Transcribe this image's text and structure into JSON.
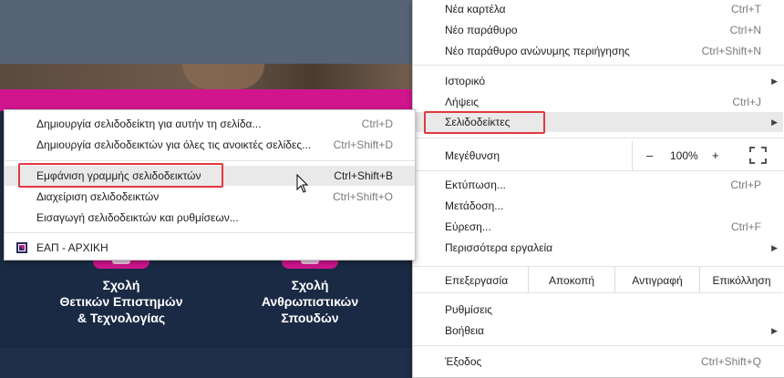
{
  "website": {
    "schools": [
      {
        "lines": [
          "Σχολή",
          "Θετικών Επιστημών",
          "& Τεχνολογίας"
        ]
      },
      {
        "lines": [
          "Σχολή",
          "Ανθρωπιστικών",
          "Σπουδών"
        ]
      }
    ]
  },
  "chrome_menu": {
    "new_tab": {
      "label": "Νέα καρτέλα",
      "shortcut": "Ctrl+T"
    },
    "new_window": {
      "label": "Νέο παράθυρο",
      "shortcut": "Ctrl+N"
    },
    "new_incognito": {
      "label": "Νέο παράθυρο ανώνυμης περιήγησης",
      "shortcut": "Ctrl+Shift+N"
    },
    "history": {
      "label": "Ιστορικό"
    },
    "downloads": {
      "label": "Λήψεις",
      "shortcut": "Ctrl+J"
    },
    "bookmarks": {
      "label": "Σελιδοδείκτες"
    },
    "zoom": {
      "label": "Μεγέθυνση",
      "minus": "–",
      "value": "100%",
      "plus": "+"
    },
    "print": {
      "label": "Εκτύπωση...",
      "shortcut": "Ctrl+P"
    },
    "cast": {
      "label": "Μετάδοση..."
    },
    "find": {
      "label": "Εύρεση...",
      "shortcut": "Ctrl+F"
    },
    "more_tools": {
      "label": "Περισσότερα εργαλεία"
    },
    "edit": {
      "label": "Επεξεργασία",
      "cut": "Αποκοπή",
      "copy": "Αντιγραφή",
      "paste": "Επικόλληση"
    },
    "settings": {
      "label": "Ρυθμίσεις"
    },
    "help": {
      "label": "Βοήθεια"
    },
    "exit": {
      "label": "Έξοδος",
      "shortcut": "Ctrl+Shift+Q"
    }
  },
  "bookmarks_menu": {
    "bookmark_page": {
      "label": "Δημιουργία σελιδοδείκτη για αυτήν τη σελίδα...",
      "shortcut": "Ctrl+D"
    },
    "bookmark_all": {
      "label": "Δημιουργία σελιδοδεικτών για όλες τις ανοικτές σελίδες...",
      "shortcut": "Ctrl+Shift+D"
    },
    "show_bar": {
      "label": "Εμφάνιση γραμμής σελιδοδεικτών",
      "shortcut": "Ctrl+Shift+B"
    },
    "manager": {
      "label": "Διαχείριση σελιδοδεικτών",
      "shortcut": "Ctrl+Shift+O"
    },
    "import": {
      "label": "Εισαγωγή σελιδοδεικτών και ρυθμίσεων..."
    },
    "eap": {
      "label": "ΕΑΠ - ΑΡΧΙΚΗ"
    }
  }
}
